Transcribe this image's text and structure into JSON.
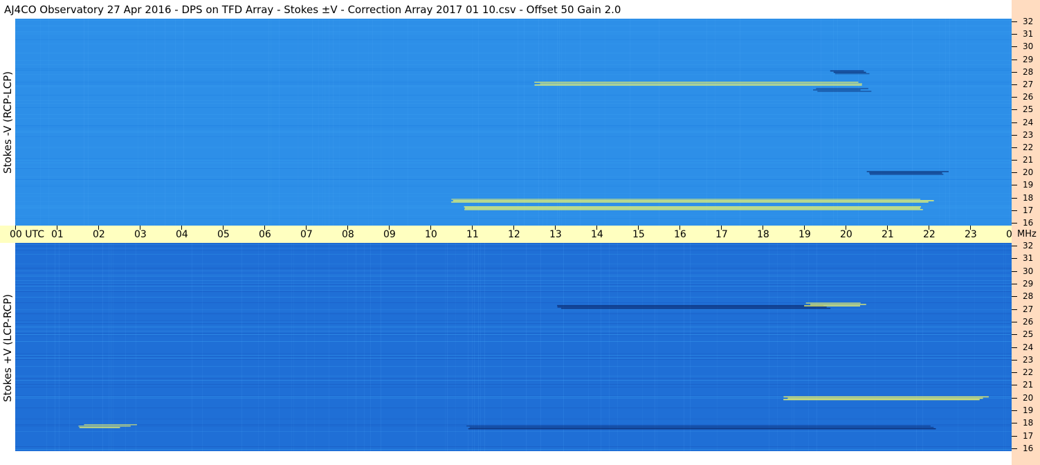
{
  "title": "AJ4CO Observatory  27 Apr 2016  -  DPS on TFD Array  -  Stokes ±V  -  Correction Array 2017 01 10.csv  -  Offset 50  Gain 2.0",
  "colors": {
    "background_top": "#2d8fe8",
    "background_bottom": "#1f6fd6",
    "timebar": "#ffffc0",
    "freq_axis": "#ffdcc0",
    "hot": "#ffff60",
    "dark": "#0a2a70"
  },
  "chart_data": [
    {
      "type": "heatmap",
      "title": "",
      "ylabel": "Stokes -V  (RCP-LCP)",
      "x_ticks": [
        "00 UTC",
        "01",
        "02",
        "03",
        "04",
        "05",
        "06",
        "07",
        "08",
        "09",
        "10",
        "11",
        "12",
        "13",
        "14",
        "15",
        "16",
        "17",
        "18",
        "19",
        "20",
        "21",
        "22",
        "23",
        "00"
      ],
      "y_ticks": [
        "32",
        "31",
        "30",
        "29",
        "28",
        "27",
        "26",
        "25",
        "24",
        "23",
        "22",
        "21",
        "20",
        "19",
        "18",
        "17",
        "16"
      ],
      "y_unit": "MHz",
      "xlim_hours_utc": [
        0,
        24
      ],
      "ylim_mhz": [
        16,
        32
      ],
      "features": [
        {
          "kind": "bright",
          "freq_mhz": 17.8,
          "start_h": 10.5,
          "end_h": 22.1
        },
        {
          "kind": "bright",
          "freq_mhz": 17.2,
          "start_h": 10.8,
          "end_h": 22.0
        },
        {
          "kind": "bright",
          "freq_mhz": 27.1,
          "start_h": 12.5,
          "end_h": 20.5
        },
        {
          "kind": "dark",
          "freq_mhz": 28.0,
          "start_h": 19.6,
          "end_h": 20.6
        },
        {
          "kind": "dark",
          "freq_mhz": 26.6,
          "start_h": 19.2,
          "end_h": 20.5
        },
        {
          "kind": "dark",
          "freq_mhz": 20.0,
          "start_h": 20.5,
          "end_h": 22.5
        }
      ]
    },
    {
      "type": "heatmap",
      "title": "",
      "ylabel": "Stokes +V  (LCP-RCP)",
      "x_ticks": [
        "00 UTC",
        "01",
        "02",
        "03",
        "04",
        "05",
        "06",
        "07",
        "08",
        "09",
        "10",
        "11",
        "12",
        "13",
        "14",
        "15",
        "16",
        "17",
        "18",
        "19",
        "20",
        "21",
        "22",
        "23",
        "00"
      ],
      "y_ticks": [
        "32",
        "31",
        "30",
        "29",
        "28",
        "27",
        "26",
        "25",
        "24",
        "23",
        "22",
        "21",
        "20",
        "19",
        "18",
        "17",
        "16"
      ],
      "y_unit": "MHz",
      "xlim_hours_utc": [
        0,
        24
      ],
      "ylim_mhz": [
        16,
        32
      ],
      "features": [
        {
          "kind": "dark",
          "freq_mhz": 17.7,
          "start_h": 10.8,
          "end_h": 22.1
        },
        {
          "kind": "dark",
          "freq_mhz": 27.2,
          "start_h": 13.0,
          "end_h": 19.5
        },
        {
          "kind": "bright",
          "freq_mhz": 27.4,
          "start_h": 19.0,
          "end_h": 20.5
        },
        {
          "kind": "bright",
          "freq_mhz": 17.8,
          "start_h": 1.5,
          "end_h": 2.8
        },
        {
          "kind": "bright",
          "freq_mhz": 20.0,
          "start_h": 18.5,
          "end_h": 23.5
        }
      ]
    }
  ]
}
